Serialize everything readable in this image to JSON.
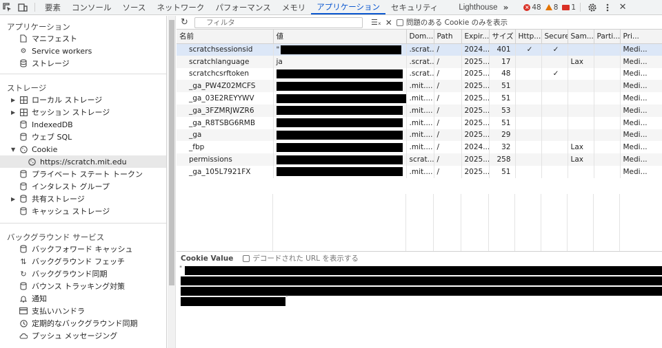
{
  "toolbar": {
    "tabs": [
      {
        "label": "要素"
      },
      {
        "label": "コンソール"
      },
      {
        "label": "ソース"
      },
      {
        "label": "ネットワーク"
      },
      {
        "label": "パフォーマンス"
      },
      {
        "label": "メモリ"
      },
      {
        "label": "アプリケーション",
        "active": true
      },
      {
        "label": "セキュリティ"
      },
      {
        "label": "Lighthouse"
      }
    ],
    "more": "»",
    "errors": "48",
    "warnings": "8",
    "issues": "1"
  },
  "sidebar": {
    "app_section": "アプリケーション",
    "app_items": [
      "マニフェスト",
      "Service workers",
      "ストレージ"
    ],
    "storage_section": "ストレージ",
    "storage_items": [
      "ローカル ストレージ",
      "セッション ストレージ",
      "IndexedDB",
      "ウェブ SQL",
      "Cookie"
    ],
    "cookie_origin": "https://scratch.mit.edu",
    "storage_items2": [
      "プライベート ステート トークン",
      "インタレスト グループ",
      "共有ストレージ",
      "キャッシュ ストレージ"
    ],
    "bg_section": "バックグラウンド サービス",
    "bg_items": [
      "バックフォワード キャッシュ",
      "バックグラウンド フェッチ",
      "バックグラウンド同期",
      "バウンス トラッキング対策",
      "通知",
      "支払いハンドラ",
      "定期的なバックグラウンド同期",
      "プッシュ メッセージング"
    ]
  },
  "filterbar": {
    "placeholder": "フィルタ",
    "problem_only": "問題のある Cookie のみを表示"
  },
  "table": {
    "headers": [
      "名前",
      "値",
      "Dom...",
      "Path",
      "Expir...",
      "サイズ",
      "Http...",
      "Secure",
      "Sam...",
      "Parti...",
      "Pri..."
    ],
    "rows": [
      {
        "name": "scratchsessionsid",
        "value": "\"",
        "domain": ".scrat...",
        "path": "/",
        "expires": "2024...",
        "size": "401",
        "http": "✓",
        "secure": "✓",
        "same": "",
        "part": "",
        "pri": "Medi..."
      },
      {
        "name": "scratchlanguage",
        "value": "ja",
        "domain": ".scrat...",
        "path": "/",
        "expires": "2025...",
        "size": "17",
        "http": "",
        "secure": "",
        "same": "Lax",
        "part": "",
        "pri": "Medi..."
      },
      {
        "name": "scratchcsrftoken",
        "value": "",
        "domain": ".scrat...",
        "path": "/",
        "expires": "2025...",
        "size": "48",
        "http": "",
        "secure": "✓",
        "same": "",
        "part": "",
        "pri": "Medi..."
      },
      {
        "name": "_ga_PW4Z02MCFS",
        "value": "",
        "domain": ".mit....",
        "path": "/",
        "expires": "2025...",
        "size": "51",
        "http": "",
        "secure": "",
        "same": "",
        "part": "",
        "pri": "Medi..."
      },
      {
        "name": "_ga_03E2REYYWV",
        "value": "",
        "domain": ".mit....",
        "path": "/",
        "expires": "2025...",
        "size": "51",
        "http": "",
        "secure": "",
        "same": "",
        "part": "",
        "pri": "Medi..."
      },
      {
        "name": "_ga_3FZMRJWZR6",
        "value": "",
        "domain": ".mit....",
        "path": "/",
        "expires": "2025...",
        "size": "53",
        "http": "",
        "secure": "",
        "same": "",
        "part": "",
        "pri": "Medi..."
      },
      {
        "name": "_ga_R8TSBG6RMB",
        "value": "",
        "domain": ".mit....",
        "path": "/",
        "expires": "2025...",
        "size": "51",
        "http": "",
        "secure": "",
        "same": "",
        "part": "",
        "pri": "Medi..."
      },
      {
        "name": "_ga",
        "value": "",
        "domain": ".mit....",
        "path": "/",
        "expires": "2025...",
        "size": "29",
        "http": "",
        "secure": "",
        "same": "",
        "part": "",
        "pri": "Medi..."
      },
      {
        "name": "_fbp",
        "value": "",
        "domain": ".mit....",
        "path": "/",
        "expires": "2024...",
        "size": "32",
        "http": "",
        "secure": "",
        "same": "Lax",
        "part": "",
        "pri": "Medi..."
      },
      {
        "name": "permissions",
        "value": "",
        "domain": "scrat...",
        "path": "/",
        "expires": "2025...",
        "size": "258",
        "http": "",
        "secure": "",
        "same": "Lax",
        "part": "",
        "pri": "Medi..."
      },
      {
        "name": "_ga_105L7921FX",
        "value": "",
        "domain": ".mit....",
        "path": "/",
        "expires": "2025...",
        "size": "51",
        "http": "",
        "secure": "",
        "same": "",
        "part": "",
        "pri": "Medi..."
      }
    ]
  },
  "value_panel": {
    "title": "Cookie Value",
    "decode_label": "デコードされた URL を表示する",
    "open_quote": "\"",
    "close_quote": "\""
  }
}
